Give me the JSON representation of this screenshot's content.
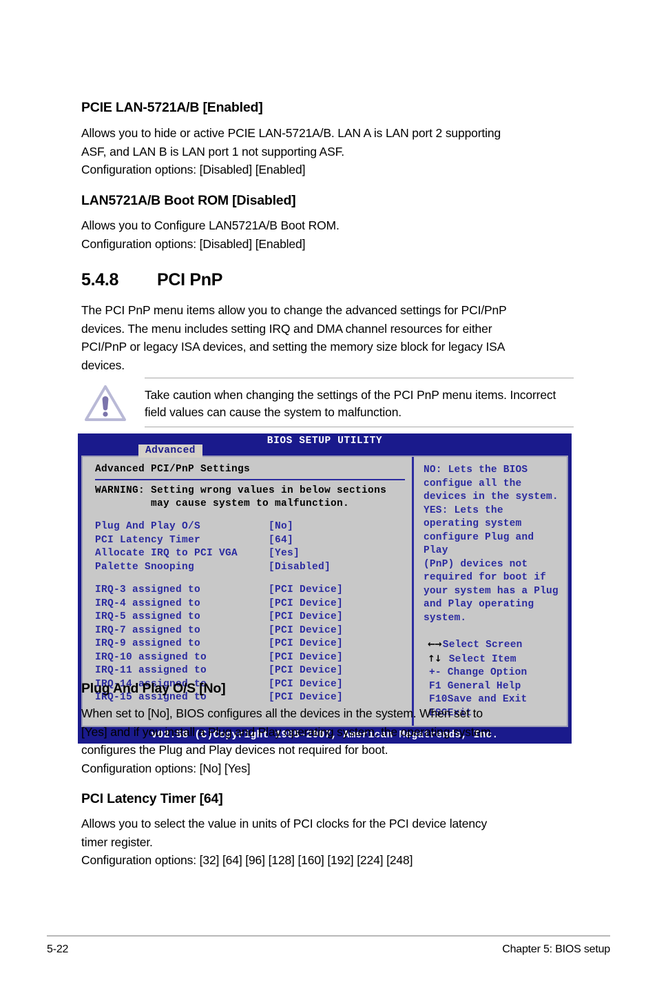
{
  "sections": {
    "pcie_lan": {
      "heading": "PCIE LAN-5721A/B [Enabled]",
      "line1": "Allows you to hide or active PCIE LAN-5721A/B. LAN A is LAN port 2 supporting",
      "line2": "ASF, and LAN B is LAN port 1 not supporting ASF.",
      "line3": "Configuration options: [Disabled] [Enabled]"
    },
    "boot_rom": {
      "heading": "LAN5721A/B Boot ROM [Disabled]",
      "line1": "Allows you to Configure LAN5721A/B Boot ROM.",
      "line2": "Configuration options: [Disabled] [Enabled]"
    },
    "pci_pnp": {
      "number": "5.4.8",
      "title": "PCI PnP",
      "line1": "The PCI PnP menu items allow you to change the advanced settings for PCI/PnP",
      "line2": "devices. The menu includes setting IRQ and DMA channel resources for either",
      "line3": "PCI/PnP or legacy ISA devices, and setting the memory size block for legacy ISA",
      "line4": "devices."
    },
    "plug_and_play": {
      "heading": "Plug And Play O/S [No]",
      "line1": "When set to [No], BIOS configures all the devices in the system. When set to",
      "line2": "[Yes] and if you install a Plug and Play operating system, the operating system",
      "line3": "configures the Plug and Play devices not required for boot.",
      "line4": "Configuration options: [No] [Yes]"
    },
    "pci_latency": {
      "heading": "PCI Latency Timer [64]",
      "line1": "Allows you to select the value in units of PCI clocks for the PCI device latency",
      "line2": "timer register.",
      "line3": "Configuration options: [32] [64] [96] [128] [160] [192] [224] [248]"
    }
  },
  "caution": {
    "icon": "warning-triangle-icon",
    "line1": "Take caution when changing the settings of the PCI PnP menu items. Incorrect",
    "line2": "field values can cause the system to malfunction."
  },
  "bios": {
    "title": "BIOS SETUP UTILITY",
    "tab": "Advanced",
    "section_title": "Advanced PCI/PnP Settings",
    "warning_line1": "WARNING: Setting wrong values in below sections",
    "warning_line2": "         may cause system to malfunction.",
    "settings": [
      {
        "label": "Plug And Play O/S",
        "value": "[No]"
      },
      {
        "label": "PCI Latency Timer",
        "value": "[64]"
      },
      {
        "label": "Allocate IRQ to PCI VGA",
        "value": "[Yes]"
      },
      {
        "label": "Palette Snooping",
        "value": "[Disabled]"
      }
    ],
    "irqs": [
      {
        "label": "IRQ-3 assigned to",
        "value": "[PCI Device]"
      },
      {
        "label": "IRQ-4 assigned to",
        "value": "[PCI Device]"
      },
      {
        "label": "IRQ-5 assigned to",
        "value": "[PCI Device]"
      },
      {
        "label": "IRQ-7 assigned to",
        "value": "[PCI Device]"
      },
      {
        "label": "IRQ-9 assigned to",
        "value": "[PCI Device]"
      },
      {
        "label": "IRQ-10 assigned to",
        "value": "[PCI Device]"
      },
      {
        "label": "IRQ-11 assigned to",
        "value": "[PCI Device]"
      },
      {
        "label": "IRQ-14 assigned to",
        "value": "[PCI Device]"
      },
      {
        "label": "IRQ-15 assigned to",
        "value": "[PCI Device]"
      }
    ],
    "help_text": "NO: Lets the BIOS\nconfigue all the\ndevices in the system.\nYES: Lets the\noperating system\nconfigure Plug and Play\n(PnP) devices not\nrequired for boot if\nyour system has a Plug\nand Play operating\nsystem.",
    "keys": [
      {
        "glyph": "←→",
        "mono": "",
        "label": "Select Screen"
      },
      {
        "glyph": "↑↓",
        "mono": "",
        "label": " Select Item"
      },
      {
        "glyph": "",
        "mono": "+-",
        "label": " Change Option"
      },
      {
        "glyph": "",
        "mono": "F1",
        "label": " General Help"
      },
      {
        "glyph": "",
        "mono": "F10",
        "label": "Save and Exit"
      },
      {
        "glyph": "",
        "mono": "ESC",
        "label": "Exit"
      }
    ],
    "footer": "v02.58 (C)Copyright 1985-2007, American Megatrends, Inc.",
    "colors": {
      "chrome_blue": "#1a1a8c",
      "text_blue": "#2b2ba0",
      "panel_gray": "#c8c8c8",
      "tab_gray": "#d4d0c8"
    }
  },
  "page_footer": {
    "page_number": "5-22",
    "chapter": "Chapter 5: BIOS setup"
  }
}
